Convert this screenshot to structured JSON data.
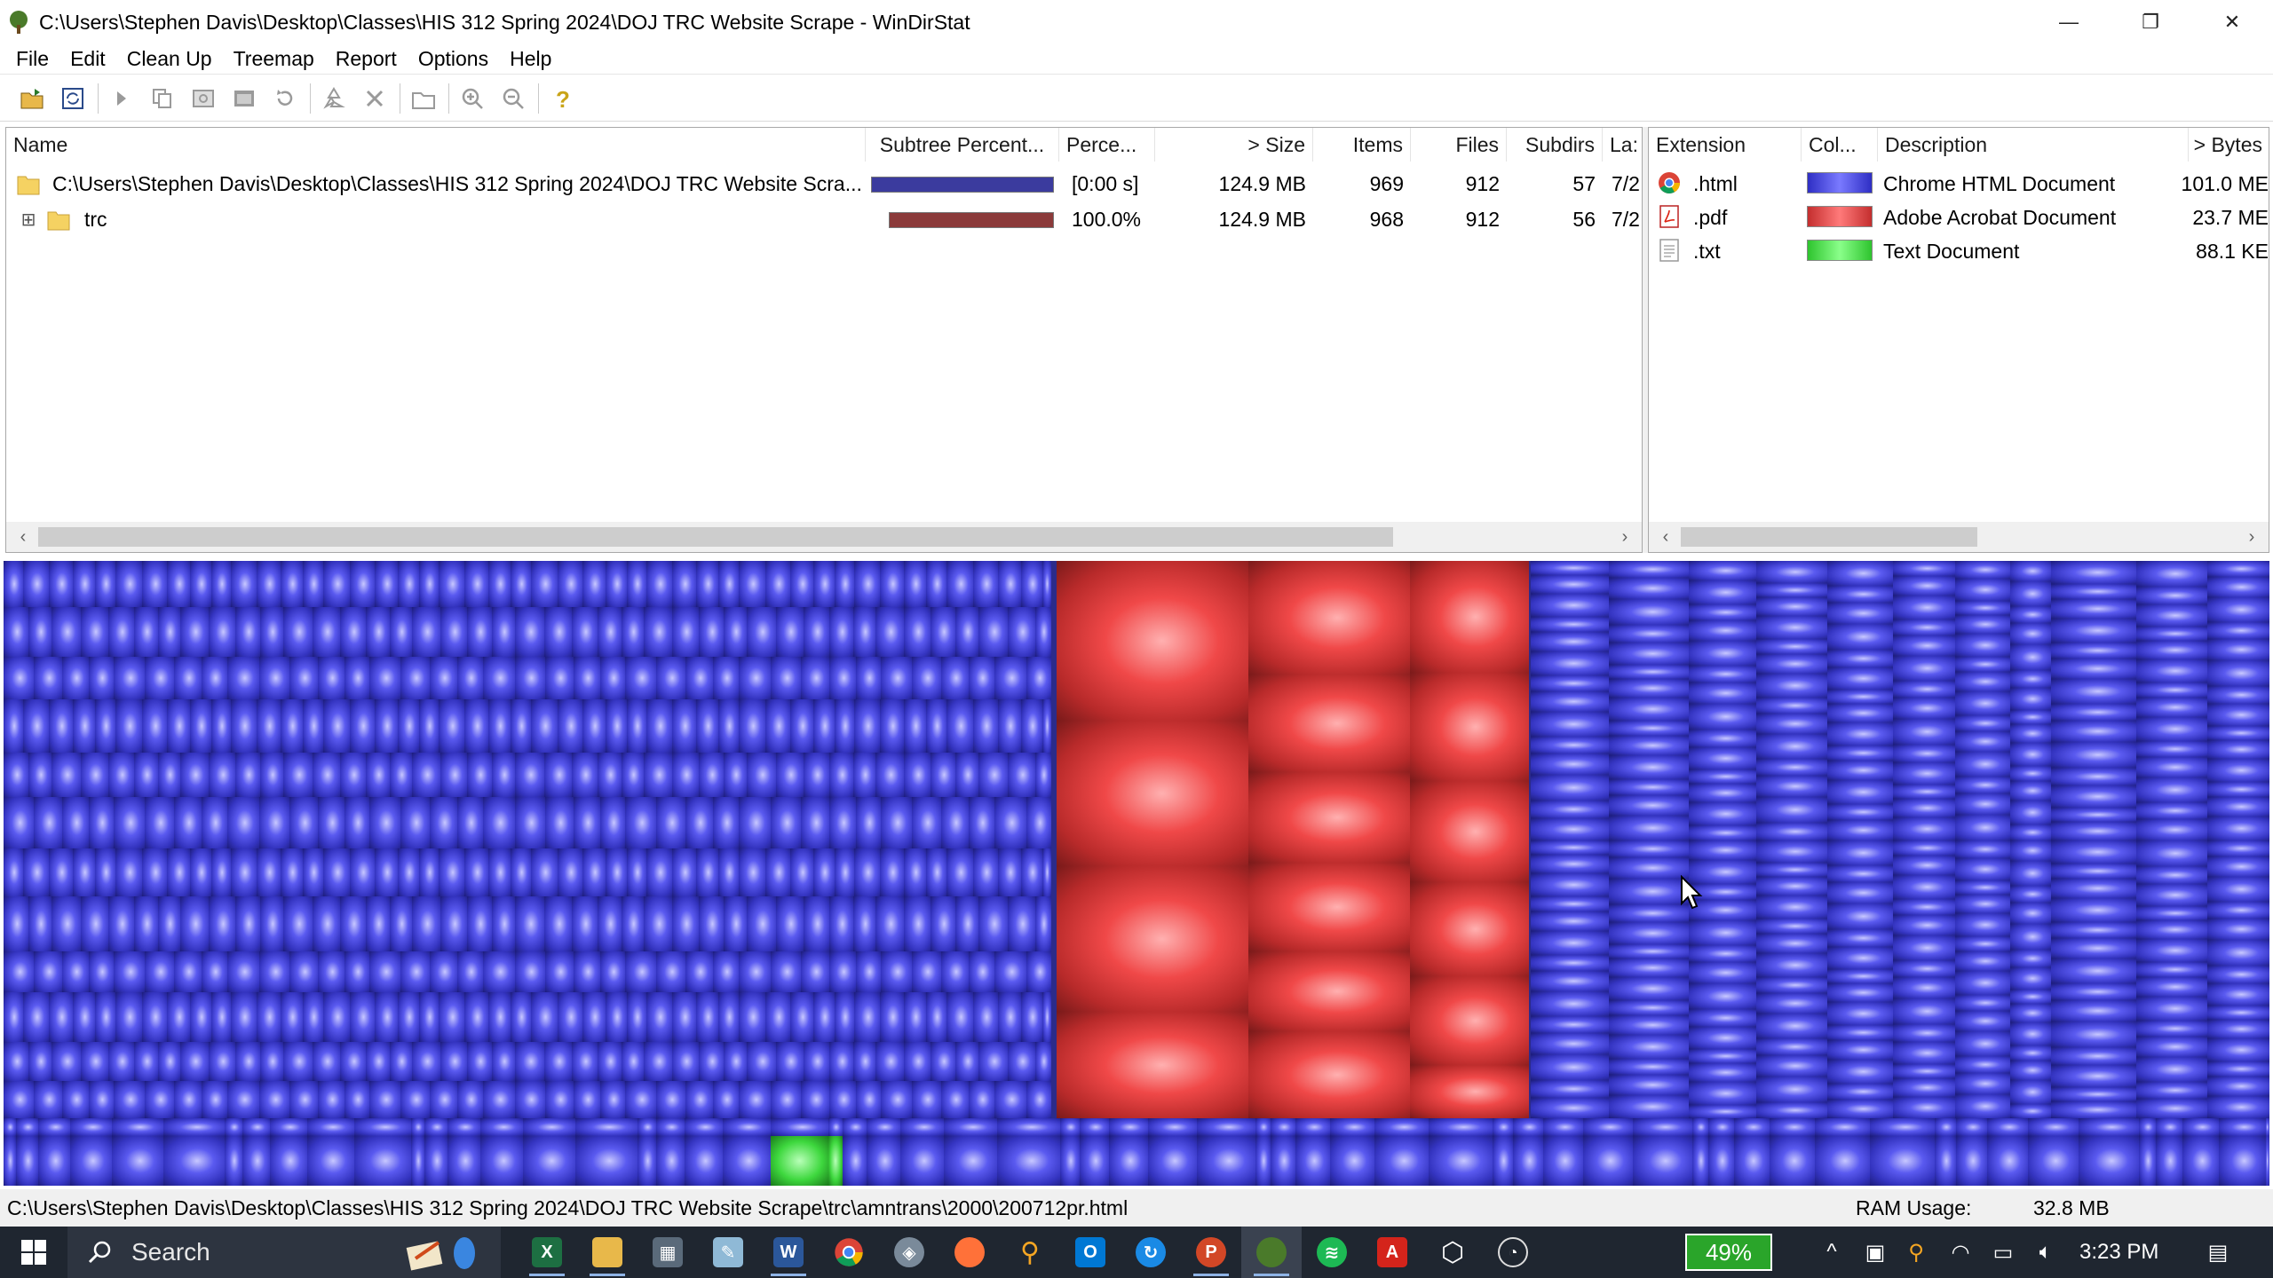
{
  "window": {
    "title": "C:\\Users\\Stephen Davis\\Desktop\\Classes\\HIS 312 Spring 2024\\DOJ TRC Website Scrape - WinDirStat",
    "minimize_glyph": "—",
    "restore_glyph": "❐",
    "close_glyph": "✕"
  },
  "menu": [
    "File",
    "Edit",
    "Clean Up",
    "Treemap",
    "Report",
    "Options",
    "Help"
  ],
  "toolbar_icons": [
    "open-icon",
    "refresh-icon",
    "play-icon",
    "copy-icon",
    "explorer-icon",
    "cmd-icon",
    "refresh-selected-icon",
    "recycle-icon",
    "delete-icon",
    "properties-icon",
    "zoom-in-icon",
    "zoom-out-icon",
    "help-icon"
  ],
  "tree": {
    "headers": {
      "name": "Name",
      "subtree": "Subtree Percent...",
      "perce": "Perce...",
      "size": "> Size",
      "items": "Items",
      "files": "Files",
      "subdirs": "Subdirs",
      "last": "La:"
    },
    "rows": [
      {
        "expander": "",
        "name": "C:\\Users\\Stephen Davis\\Desktop\\Classes\\HIS 312 Spring 2024\\DOJ TRC Website Scra...",
        "bar_fraction": 1.0,
        "bar_color": "#3b3b9e",
        "perce": "[0:00 s]",
        "size": "124.9 MB",
        "items": "969",
        "files": "912",
        "subdirs": "57",
        "last": "7/2"
      },
      {
        "expander": "⊞",
        "name": "trc",
        "bar_fraction": 1.0,
        "bar_color": "#8b3a3a",
        "perce": "100.0%",
        "size": "124.9 MB",
        "items": "968",
        "files": "912",
        "subdirs": "56",
        "last": "7/2"
      }
    ]
  },
  "extensions": {
    "headers": {
      "extension": "Extension",
      "color": "Col...",
      "description": "Description",
      "bytes": "> Bytes"
    },
    "rows": [
      {
        "ext": ".html",
        "icon": "chrome-icon",
        "color": "#4b4bf0",
        "description": "Chrome HTML Document",
        "bytes": "101.0 ME"
      },
      {
        "ext": ".pdf",
        "icon": "pdf-icon",
        "color": "#f04b4b",
        "description": "Adobe Acrobat Document",
        "bytes": "23.7 ME"
      },
      {
        "ext": ".txt",
        "icon": "text-file-icon",
        "color": "#4bd84b",
        "description": "Text Document",
        "bytes": "88.1 KE"
      }
    ]
  },
  "statusbar": {
    "path": "C:\\Users\\Stephen Davis\\Desktop\\Classes\\HIS 312 Spring 2024\\DOJ TRC Website Scrape\\trc\\amntrans\\2000\\200712pr.html",
    "ram_label": "RAM Usage:",
    "ram_value": "32.8 MB"
  },
  "taskbar": {
    "search_placeholder": "Search",
    "battery": "49%",
    "time": "3:23 PM"
  }
}
